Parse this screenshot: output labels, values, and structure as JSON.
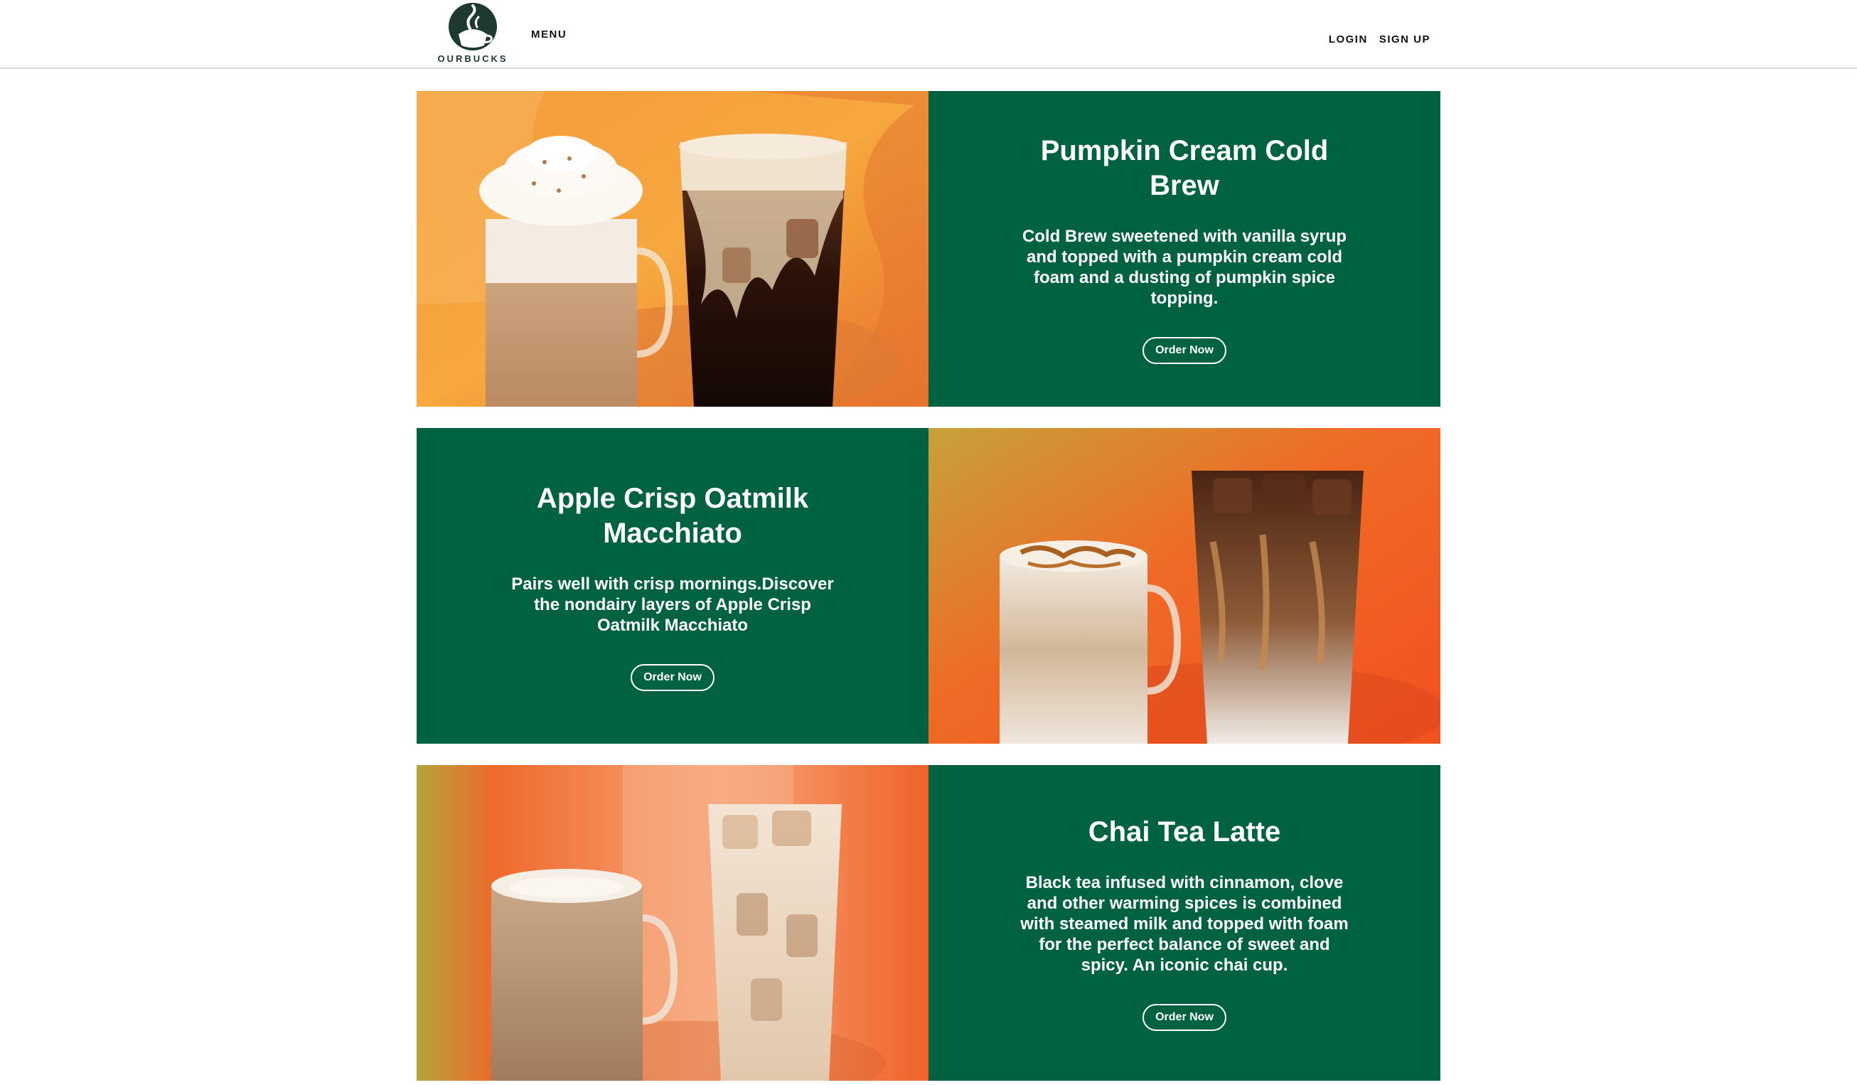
{
  "header": {
    "brand": "OURBUCKS",
    "menu_label": "MENU",
    "login_label": "LOGIN",
    "signup_label": "SIGN UP"
  },
  "features": [
    {
      "title": "Pumpkin Cream Cold Brew",
      "description": "Cold Brew sweetened with vanilla syrup and topped with a pumpkin cream cold foam and a dusting of pumpkin spice topping.",
      "button_label": "Order Now",
      "image_side": "left",
      "image": "pumpkin-drinks-image"
    },
    {
      "title": "Apple Crisp Oatmilk Macchiato",
      "description": "Pairs well with crisp mornings.Discover the nondairy layers of Apple Crisp Oatmilk Macchiato",
      "button_label": "Order Now",
      "image_side": "right",
      "image": "apple-crisp-drinks-image"
    },
    {
      "title": "Chai Tea Latte",
      "description": "Black tea infused with cinnamon, clove and other warming spices is combined with steamed milk and topped with foam for the perfect balance of sweet and spicy. An iconic chai cup.",
      "button_label": "Order Now",
      "image_side": "left",
      "image": "chai-drinks-image"
    }
  ],
  "colors": {
    "brand_green": "#006241",
    "logo_green": "#1e3932"
  }
}
